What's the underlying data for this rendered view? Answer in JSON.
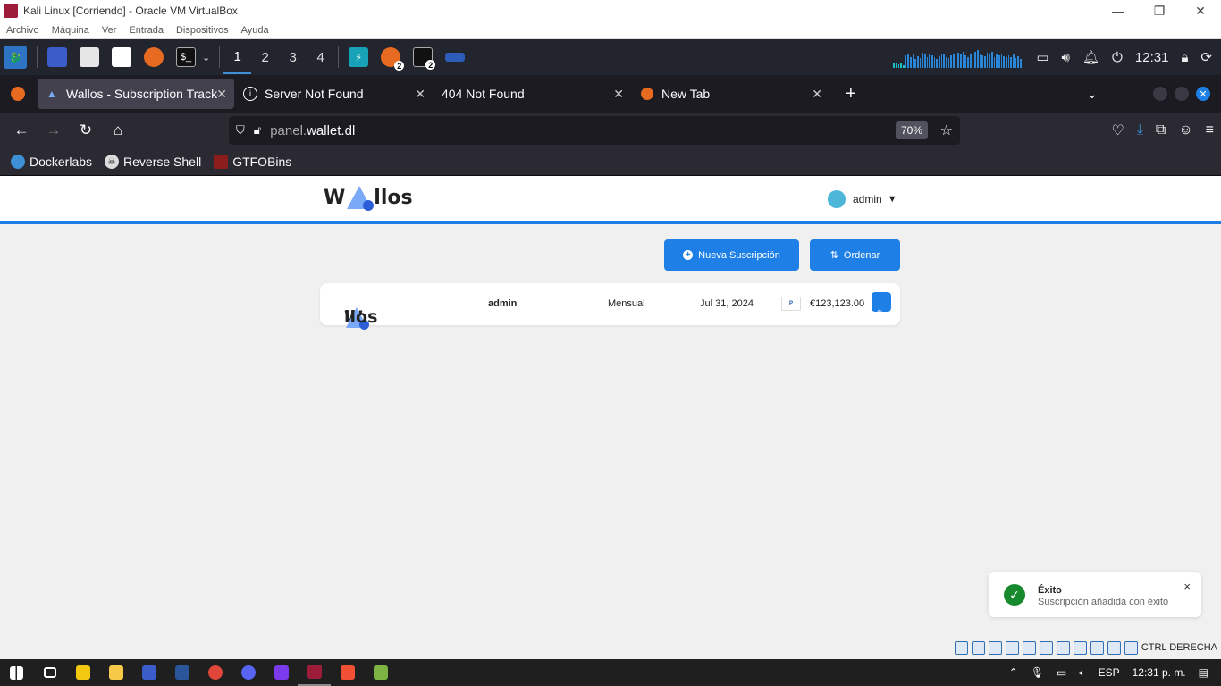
{
  "vbox": {
    "title": "Kali Linux [Corriendo] - Oracle VM VirtualBox",
    "menu": [
      "Archivo",
      "Máquina",
      "Ver",
      "Entrada",
      "Dispositivos",
      "Ayuda"
    ],
    "status_key": "CTRL DERECHA"
  },
  "kali": {
    "workspaces": [
      "1",
      "2",
      "3",
      "4"
    ],
    "active_workspace": "1",
    "badge_firefox": "2",
    "badge_terminal": "2",
    "clock": "12:31"
  },
  "browser": {
    "tabs": [
      {
        "label": "Wallos - Subscription Tracker",
        "icon": "wallos-icon",
        "active": true
      },
      {
        "label": "Server Not Found",
        "icon": "info-icon",
        "active": false
      },
      {
        "label": "404 Not Found",
        "icon": "",
        "active": false
      },
      {
        "label": "New Tab",
        "icon": "firefox-icon",
        "active": false
      }
    ],
    "url_prefix": "panel.",
    "url_host": "wallet.dl",
    "zoom": "70%",
    "bookmarks": [
      {
        "label": "Dockerlabs",
        "icon": "docker-icon"
      },
      {
        "label": "Reverse Shell",
        "icon": "skull-icon"
      },
      {
        "label": "GTFOBins",
        "icon": "gtfobins-icon"
      }
    ]
  },
  "app": {
    "logo_text_left": "W",
    "logo_text_right": "llos",
    "user": "admin",
    "user_caret": "▼",
    "btn_new": "Nueva Suscripción",
    "btn_sort": "Ordenar",
    "subscription": {
      "name": "admin",
      "cycle": "Mensual",
      "date": "Jul 31, 2024",
      "payment": "PayPal",
      "price": "€123,123.00"
    },
    "toast": {
      "title": "Éxito",
      "message": "Suscripción añadida con éxito",
      "close": "×"
    }
  },
  "windows": {
    "language": "ESP",
    "time": "12:31 p. m."
  },
  "colors": {
    "accent": "#1e7fe6",
    "success": "#188a2e",
    "kali_panel": "#23252e",
    "firefox_tabbar": "#1c1b22"
  }
}
